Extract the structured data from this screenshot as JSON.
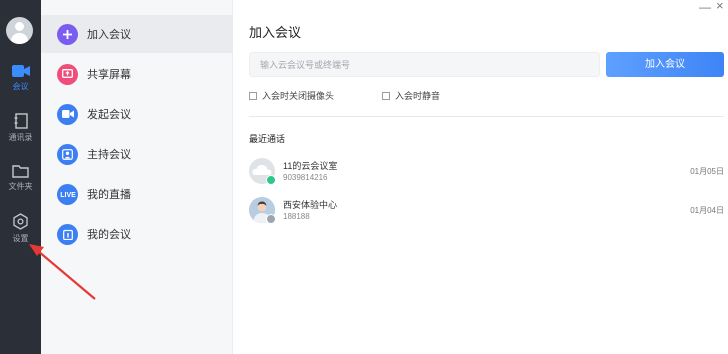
{
  "sidebar": {
    "items": [
      {
        "label": "会议",
        "icon": "video-camera-icon",
        "active": true
      },
      {
        "label": "通讯录",
        "icon": "contacts-book-icon",
        "active": false
      },
      {
        "label": "文件夹",
        "icon": "folder-icon",
        "active": false
      },
      {
        "label": "设置",
        "icon": "gear-icon",
        "active": false
      }
    ]
  },
  "nav": {
    "items": [
      {
        "label": "加入会议",
        "icon": "plus-icon",
        "color": "#7b5cf0",
        "active": true
      },
      {
        "label": "共享屏幕",
        "icon": "share-screen-icon",
        "color": "#f04e7a",
        "active": false
      },
      {
        "label": "发起会议",
        "icon": "video-camera-icon",
        "color": "#3b7ff2",
        "active": false
      },
      {
        "label": "主持会议",
        "icon": "host-icon",
        "color": "#3b7ff2",
        "active": false
      },
      {
        "label": "我的直播",
        "icon": "live-icon",
        "color": "#3b7ff2",
        "active": false
      },
      {
        "label": "我的会议",
        "icon": "calendar-icon",
        "color": "#3b7ff2",
        "active": false
      }
    ]
  },
  "main": {
    "title": "加入会议",
    "input_placeholder": "输入云会议号或终端号",
    "join_button": "加入会议",
    "options": [
      "入会时关闭摄像头",
      "入会时静音"
    ],
    "recent_title": "最近通话",
    "recent": [
      {
        "name": "11的云会议室",
        "number": "9039814216",
        "date": "01月05日",
        "avatar": "cloud-avatar-icon"
      },
      {
        "name": "西安体验中心",
        "number": "188188",
        "date": "01月04日",
        "avatar": "person-avatar"
      }
    ]
  },
  "window": {
    "minimize": "—",
    "close": "×"
  },
  "colors": {
    "rail": "#2b2f38",
    "accent": "#3b8cff",
    "annotation_arrow": "#e53935"
  }
}
